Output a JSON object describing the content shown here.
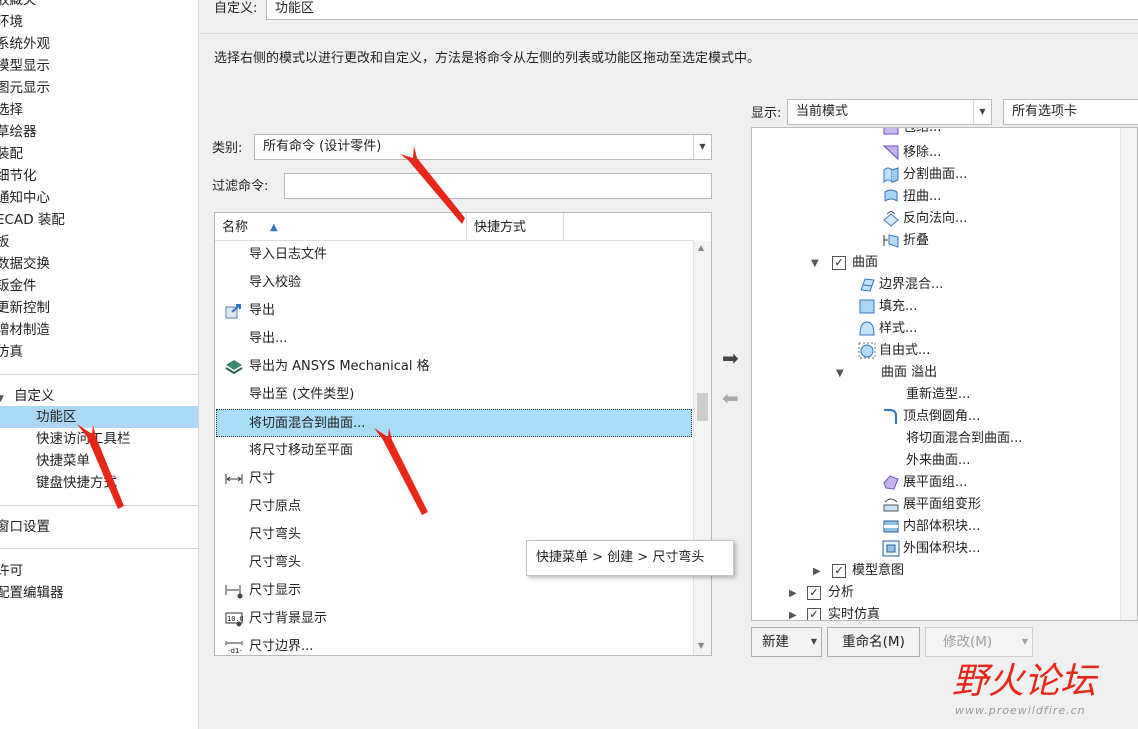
{
  "nav": {
    "items": [
      "收藏夹",
      "环境",
      "系统外观",
      "模型显示",
      "图元显示",
      "选择",
      "草绘器",
      "装配",
      "细节化",
      "通知中心",
      "ECAD 装配",
      "板",
      "数据交换",
      "钣金件",
      "更新控制",
      "增材制造",
      "仿真"
    ],
    "customize": "自定义",
    "customize_items": [
      "功能区",
      "快速访问工具栏",
      "快捷菜单",
      "键盘快捷方式"
    ],
    "window_settings": "窗口设置",
    "bottom_items": [
      "许可",
      "配置编辑器"
    ]
  },
  "header": {
    "customize_label": "自定义:",
    "customize_value": "功能区"
  },
  "instruction": "选择右侧的模式以进行更改和自定义，方法是将命令从左侧的列表或功能区拖动至选定模式中。",
  "category": {
    "label": "类别:",
    "value": "所有命令 (设计零件)"
  },
  "filter": {
    "label": "过滤命令:",
    "value": ""
  },
  "columns": {
    "name": "名称",
    "shortcut": "快捷方式"
  },
  "commands": [
    {
      "label": "导入日志文件",
      "icon": ""
    },
    {
      "label": "导入校验",
      "icon": ""
    },
    {
      "label": "导出",
      "icon": "export-icon"
    },
    {
      "label": "导出...",
      "icon": ""
    },
    {
      "label": "导出为 ANSYS Mechanical 格",
      "icon": "ansys-icon"
    },
    {
      "label": "导出至 (文件类型)",
      "icon": ""
    },
    {
      "label": "将切面混合到曲面...",
      "icon": ""
    },
    {
      "label": "将尺寸移动至平面",
      "icon": ""
    },
    {
      "label": "尺寸",
      "icon": "dimension-icon"
    },
    {
      "label": "尺寸原点",
      "icon": ""
    },
    {
      "label": "尺寸弯头",
      "icon": ""
    },
    {
      "label": "尺寸弯头",
      "icon": ""
    },
    {
      "label": "尺寸显示",
      "icon": "dimension-display-icon"
    },
    {
      "label": "尺寸背景显示",
      "icon": "dimension-background-icon"
    },
    {
      "label": "尺寸边界...",
      "icon": "dimension-boundary-icon"
    }
  ],
  "display": {
    "label": "显示:",
    "mode": "当前模式",
    "tabs": "所有选项卡"
  },
  "tree": {
    "partial_top": "包络...",
    "items_a": [
      "移除...",
      "分割曲面...",
      "扭曲...",
      "反向法向...",
      "折叠"
    ],
    "surface_group": "曲面",
    "items_b": [
      "边界混合...",
      "填充...",
      "样式...",
      "自由式..."
    ],
    "overflow_group": "曲面 溢出",
    "items_c": [
      "重新造型...",
      "顶点倒圆角...",
      "将切面混合到曲面...",
      "外来曲面...",
      "展平面组...",
      "展平面组变形",
      "内部体积块...",
      "外围体积块..."
    ],
    "model_intent": "模型意图",
    "analysis": "分析",
    "simulation": "实时仿真"
  },
  "buttons": {
    "new": "新建",
    "rename": "重命名(M)",
    "modify": "修改(M)"
  },
  "tooltip": "快捷菜单 > 创建 > 尺寸弯头",
  "watermark": {
    "text": "野火论坛",
    "url": "www.proewildfire.cn"
  },
  "colors": {
    "selection": "#a9dcf6",
    "annotation_arrow": "#e8261a"
  }
}
